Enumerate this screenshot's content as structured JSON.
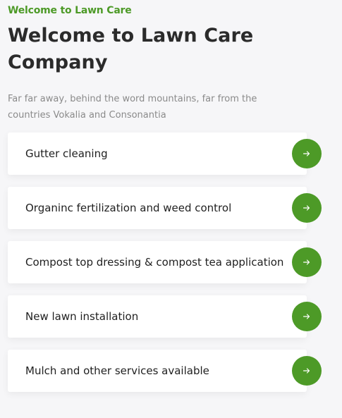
{
  "header": {
    "subtitle": "Welcome to Lawn Care",
    "title": "Welcome to Lawn Care Company",
    "description": "Far far away, behind the word mountains, far from the countries Vokalia and Consonantia"
  },
  "services": [
    {
      "label": "Gutter cleaning",
      "icon": "arrow-right-icon"
    },
    {
      "label": "Organinc fertilization and weed control",
      "icon": "arrow-right-icon"
    },
    {
      "label": "Compost top dressing & compost tea application",
      "icon": "arrow-right-icon"
    },
    {
      "label": "New lawn installation",
      "icon": "arrow-right-icon"
    },
    {
      "label": "Mulch and other services available",
      "icon": "arrow-right-icon"
    }
  ],
  "colors": {
    "accent": "#4d9a27",
    "background": "#f6f6f8",
    "card": "#ffffff",
    "heading": "#2b2b2b",
    "muted": "#8a8a8a"
  }
}
